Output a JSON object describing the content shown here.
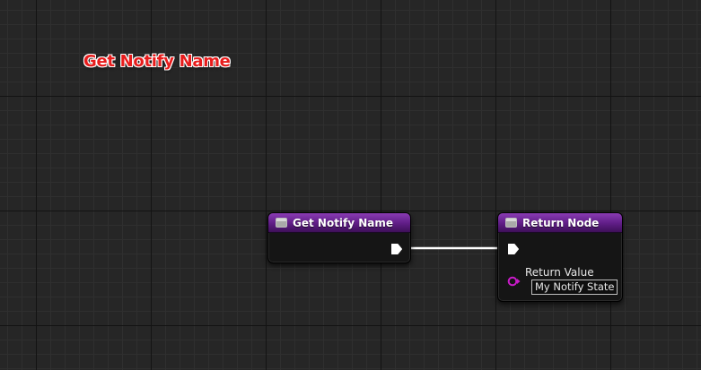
{
  "graph": {
    "title": "Get Notify Name"
  },
  "nodes": {
    "entry": {
      "title": "Get Notify Name",
      "icon": "function-icon"
    },
    "return": {
      "title": "Return Node",
      "icon": "function-icon",
      "pins": {
        "return_value": {
          "label": "Return Value",
          "value": "My Notify State"
        }
      }
    }
  },
  "colors": {
    "node_header": "#5f1d86",
    "exec_wire": "#ffffff",
    "name_pin": "#c81bc8",
    "graph_title": "#e81c1c"
  }
}
